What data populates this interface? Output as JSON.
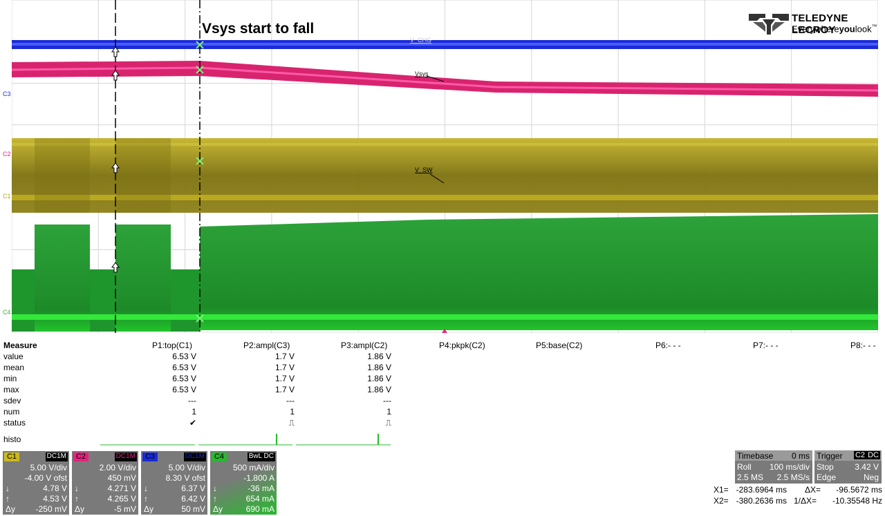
{
  "brand": {
    "name": "TELEDYNE LECROY",
    "tagline_pre": "Everywhere",
    "tagline_bold": "you",
    "tagline_post": "look",
    "trademark": "™"
  },
  "annotation": "Vsys start to fall",
  "waveform_labels": {
    "vchg": "V_CHG",
    "vsys": "Vsys",
    "vsw": "V_SW"
  },
  "axis_labels": {
    "c1": "C1",
    "c2": "C2",
    "c3": "C3",
    "c4": "C4"
  },
  "colors": {
    "c1": "#cbb91a",
    "c2": "#e8217f",
    "c3": "#1a2bd8",
    "c4": "#29b82e",
    "grid": "#d6d6d6"
  },
  "measure": {
    "title": "Measure",
    "columns": [
      "P1:top(C1)",
      "P2:ampl(C3)",
      "P3:ampl(C2)",
      "P4:pkpk(C2)",
      "P5:base(C2)",
      "P6:- - -",
      "P7:- - -",
      "P8:- - -"
    ],
    "rows": [
      {
        "label": "value",
        "cells": [
          "6.53 V",
          "1.7 V",
          "1.86 V"
        ]
      },
      {
        "label": "mean",
        "cells": [
          "6.53 V",
          "1.7 V",
          "1.86 V"
        ]
      },
      {
        "label": "min",
        "cells": [
          "6.53 V",
          "1.7 V",
          "1.86 V"
        ]
      },
      {
        "label": "max",
        "cells": [
          "6.53 V",
          "1.7 V",
          "1.86 V"
        ]
      },
      {
        "label": "sdev",
        "cells": [
          "---",
          "---",
          "---"
        ]
      },
      {
        "label": "num",
        "cells": [
          "1",
          "1",
          "1"
        ]
      },
      {
        "label": "status",
        "cells": [
          "✔",
          "⎍",
          "⎍"
        ]
      }
    ],
    "histo_label": "histo"
  },
  "channels": [
    {
      "tag": "C1",
      "coupling": "DC1M",
      "scale": "5.00 V/div",
      "offset": "-4.00 V ofst",
      "down": "4.78 V",
      "up": "4.53 V",
      "dy": "-250 mV",
      "color": "#cbb91a",
      "cplColor": "#ffffff"
    },
    {
      "tag": "C2",
      "coupling": "DC1M",
      "scale": "2.00 V/div",
      "offset": "450 mV",
      "down": "4.271 V",
      "up": "4.265 V",
      "dy": "-5 mV",
      "color": "#e8217f",
      "cplColor": "#e8217f"
    },
    {
      "tag": "C3",
      "coupling": "DC1M",
      "scale": "5.00 V/div",
      "offset": "8.30 V ofst",
      "down": "6.37 V",
      "up": "6.42 V",
      "dy": "50 mV",
      "color": "#1a2bd8",
      "cplColor": "#1a2bd8"
    },
    {
      "tag": "C4",
      "coupling": "BwL DC",
      "scale": "500 mA/div",
      "offset": "-1.800 A",
      "down": "-36 mA",
      "up": "654 mA",
      "dy": "690 mA",
      "color": "#29b82e",
      "cplColor": "#ffffff"
    }
  ],
  "arrows": {
    "down": "↓",
    "up": "↑",
    "dy": "Δy"
  },
  "timebase": {
    "title": "Timebase",
    "delay": "0 ms",
    "mode": "Roll",
    "scale": "100 ms/div",
    "samples": "2.5 MS",
    "rate": "2.5 MS/s"
  },
  "trigger": {
    "title": "Trigger",
    "source": "C2",
    "coupling": "DC",
    "state": "Stop",
    "level": "3.42 V",
    "type": "Edge",
    "slope": "Neg"
  },
  "cursors": {
    "x1_label": "X1=",
    "x1": "-283.6964 ms",
    "dx_label": "ΔX=",
    "dx": "-96.5672 ms",
    "x2_label": "X2=",
    "x2": "-380.2636 ms",
    "inv_label": "1/ΔX=",
    "inv": "-10.35548 Hz"
  }
}
